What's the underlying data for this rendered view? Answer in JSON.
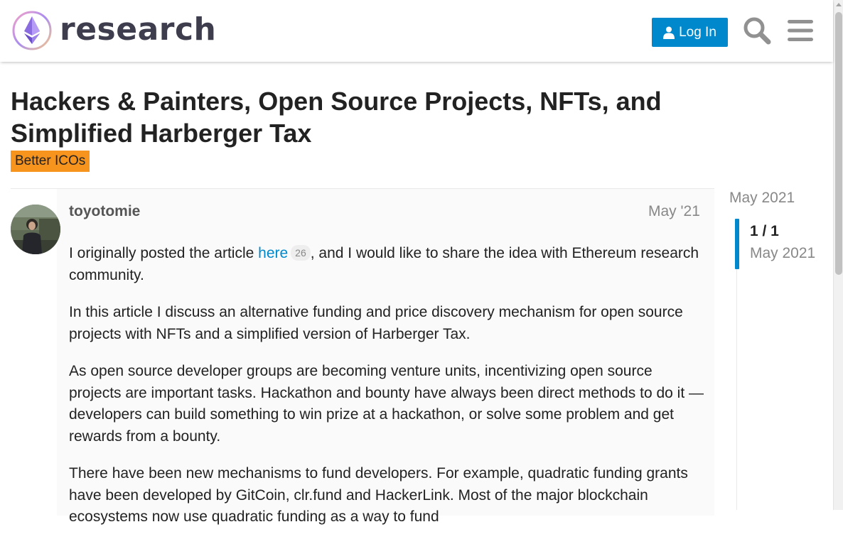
{
  "header": {
    "site_name": "research",
    "login_label": "Log In",
    "icons": [
      "ethereum-logo",
      "user-icon",
      "search-icon",
      "menu-icon"
    ],
    "accent": "#0088cc"
  },
  "topic": {
    "title": "Hackers & Painters, Open Source Projects, NFTs, and Simplified Harberger Tax",
    "category": "Better ICOs",
    "category_color": "#f7941d"
  },
  "post": {
    "author": "toyotomie",
    "date": "May '21",
    "p1_before": "I originally posted the article ",
    "p1_link": "here",
    "p1_clicks": "26",
    "p1_after": ", and I would like to share the idea with Ethereum research community.",
    "p2": "In this article I discuss an alternative funding and price discovery mechanism for open source projects with NFTs and a simplified version of Harberger Tax.",
    "p3": "As open source developer groups are becoming venture units, incentivizing open source projects are important tasks. Hackathon and bounty have always been direct methods to do it — developers can build something to win prize at a hackathon, or solve some problem and get rewards from a bounty.",
    "p4": "There have been new mechanisms to fund developers. For example, quadratic funding grants have been developed by GitCoin, clr.fund and HackerLink. Most of the major blockchain ecosystems now use quadratic funding as a way to fund"
  },
  "timeline": {
    "start": "May 2021",
    "count": "1 / 1",
    "date": "May 2021"
  }
}
